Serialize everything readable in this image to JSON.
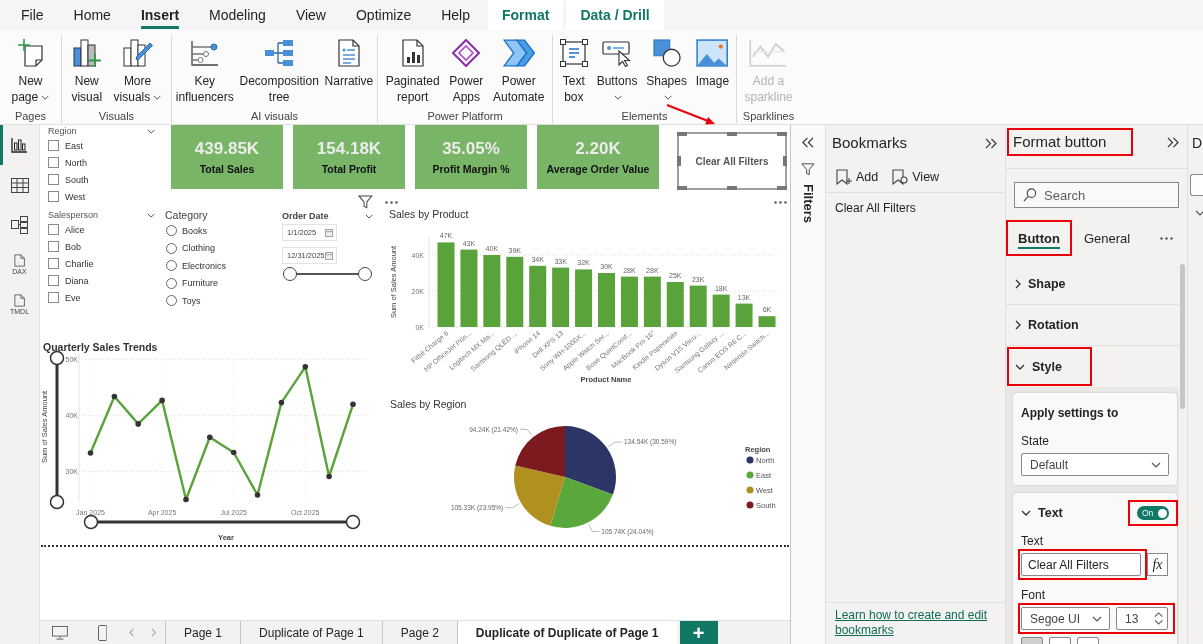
{
  "ribbon": {
    "tabs": [
      {
        "label": "File",
        "selected": false,
        "kind": "standard"
      },
      {
        "label": "Home",
        "selected": false,
        "kind": "standard"
      },
      {
        "label": "Insert",
        "selected": true,
        "kind": "standard"
      },
      {
        "label": "Modeling",
        "selected": false,
        "kind": "standard"
      },
      {
        "label": "View",
        "selected": false,
        "kind": "standard"
      },
      {
        "label": "Optimize",
        "selected": false,
        "kind": "standard"
      },
      {
        "label": "Help",
        "selected": false,
        "kind": "standard"
      },
      {
        "label": "Format",
        "selected": false,
        "kind": "contextual"
      },
      {
        "label": "Data / Drill",
        "selected": false,
        "kind": "contextual"
      }
    ],
    "groups": [
      {
        "label": "Pages",
        "buttons": [
          {
            "label": "New\npage",
            "dropdown": true,
            "disabled": false
          }
        ]
      },
      {
        "label": "Visuals",
        "buttons": [
          {
            "label": "New\nvisual",
            "dropdown": false,
            "disabled": false
          },
          {
            "label": "More\nvisuals",
            "dropdown": true,
            "disabled": false
          }
        ]
      },
      {
        "label": "AI visuals",
        "buttons": [
          {
            "label": "Key\ninfluencers",
            "dropdown": false,
            "disabled": false
          },
          {
            "label": "Decomposition\ntree",
            "dropdown": false,
            "disabled": false
          },
          {
            "label": "Narrative",
            "dropdown": false,
            "disabled": false
          }
        ]
      },
      {
        "label": "Power Platform",
        "buttons": [
          {
            "label": "Paginated\nreport",
            "dropdown": false,
            "disabled": false
          },
          {
            "label": "Power\nApps",
            "dropdown": false,
            "disabled": false
          },
          {
            "label": "Power\nAutomate",
            "dropdown": false,
            "disabled": false
          }
        ]
      },
      {
        "label": "Elements",
        "buttons": [
          {
            "label": "Text\nbox",
            "dropdown": false,
            "disabled": false
          },
          {
            "label": "Buttons",
            "dropdown": true,
            "disabled": false
          },
          {
            "label": "Shapes",
            "dropdown": true,
            "disabled": false
          },
          {
            "label": "Image",
            "dropdown": false,
            "disabled": false
          }
        ]
      },
      {
        "label": "Sparklines",
        "buttons": [
          {
            "label": "Add a\nsparkline",
            "dropdown": false,
            "disabled": true
          }
        ]
      }
    ]
  },
  "nav": [
    {
      "selected": true
    },
    {
      "selected": false
    },
    {
      "selected": false
    },
    {
      "label": "DAX",
      "selected": false
    },
    {
      "label": "TMDL",
      "selected": false
    }
  ],
  "canvas": {
    "region_slicer": {
      "title": "Region",
      "items": [
        {
          "label": "East",
          "checked": false
        },
        {
          "label": "North",
          "checked": false
        },
        {
          "label": "South",
          "checked": false
        },
        {
          "label": "West",
          "checked": false
        }
      ]
    },
    "salesperson_slicer": {
      "title": "Salesperson",
      "items": [
        {
          "label": "Alice",
          "checked": false
        },
        {
          "label": "Bob",
          "checked": false
        },
        {
          "label": "Charlie",
          "checked": false
        },
        {
          "label": "Diana",
          "checked": false
        },
        {
          "label": "Eve",
          "checked": false
        }
      ]
    },
    "category_slicer": {
      "title": "Category",
      "items": [
        {
          "label": "Books",
          "selected": false
        },
        {
          "label": "Clothing",
          "selected": false
        },
        {
          "label": "Electronics",
          "selected": false
        },
        {
          "label": "Furniture",
          "selected": false
        },
        {
          "label": "Toys",
          "selected": false
        }
      ]
    },
    "date_slicer": {
      "title": "Order Date",
      "start": "1/1/2025",
      "end": "12/31/2025",
      "handles": [
        {
          "level": 0
        },
        {
          "level": 1
        }
      ]
    },
    "kpi_cards": [
      {
        "value": "439.85K",
        "label": "Total Sales"
      },
      {
        "value": "154.18K",
        "label": "Total Profit"
      },
      {
        "value": "35.05%",
        "label": "Profit Margin %"
      },
      {
        "value": "2.20K",
        "label": "Average Order Value"
      }
    ],
    "clear_filters_button": {
      "label": "Clear All Filters",
      "selected": true
    },
    "sales_by_product": {
      "chart_data": {
        "type": "bar",
        "title": "Sales by Product",
        "xlabel": "Product Name",
        "ylabel": "Sum of Sales Amount",
        "categories": [
          "Fitbit Charge 6",
          "HP OfficeJet Prin...",
          "Logitech MX Ma...",
          "Samsung QLED ...",
          "iPhone 14",
          "Dell XPS 13",
          "Sony WH-1000X...",
          "Apple Watch Ser...",
          "Bose QuietComf...",
          "MacBook Pro 16\"",
          "Kindle Paperwhite",
          "Dyson V15 Vacu...",
          "Samsung Galaxy ...",
          "Canon EOS R6 C...",
          "Nintendo Switch..."
        ],
        "values": [
          47,
          43,
          40,
          39,
          34,
          33,
          32,
          30,
          28,
          28,
          25,
          23,
          18,
          13,
          6
        ],
        "ylim": [
          0,
          50
        ],
        "yticks": [
          {
            "value": 0,
            "label": "0K"
          },
          {
            "value": 20,
            "label": "20K"
          },
          {
            "value": 40,
            "label": "40K"
          }
        ],
        "grid": true,
        "value_labels": [
          "47K",
          "43K",
          "40K",
          "39K",
          "34K",
          "33K",
          "32K",
          "30K",
          "28K",
          "28K",
          "25K",
          "23K",
          "18K",
          "13K",
          "6K"
        ]
      }
    },
    "quarterly_sales_trends": {
      "chart_data": {
        "type": "line",
        "title": "Quarterly Sales Trends",
        "xlabel": "Year",
        "ylabel": "Sum of Sales Amount",
        "categories": [
          "Jan 2025",
          null,
          null,
          "Apr 2025",
          null,
          null,
          "Jul 2025",
          null,
          null,
          "Oct 2025",
          null,
          null
        ],
        "values": [
          33.3,
          43.4,
          38.5,
          42.7,
          25,
          36.1,
          33.4,
          25.8,
          42.3,
          48.7,
          29.1,
          42
        ],
        "ylim": [
          24.5,
          51
        ],
        "yticks": [
          {
            "value": 30,
            "label": "30K"
          },
          {
            "value": 40,
            "label": "40K"
          },
          {
            "value": 50,
            "label": "50K"
          }
        ],
        "grid": true
      },
      "zoom_sliders": {
        "x": [
          {
            "level": 0
          },
          {
            "level": 1
          }
        ],
        "y": [
          {
            "level": 0
          },
          {
            "level": 1
          }
        ]
      }
    },
    "sales_by_region": {
      "chart_data": {
        "type": "pie",
        "title": "Sales by Region",
        "categories": [
          "North",
          "East",
          "West",
          "South"
        ],
        "values": [
          30.59,
          24.04,
          23.95,
          21.42
        ],
        "value_labels": [
          "134.54K (30.59%)",
          "105.74K (24.04%)",
          "105.33K (23.95%)",
          "94.24K (21.42%)"
        ],
        "colors": [
          "#2c3566",
          "#5aa83c",
          "#b0901f",
          "#7d1a20"
        ],
        "legend": "right"
      },
      "legend_title": "Region"
    },
    "page_tabs": {
      "tabs": [
        {
          "label": "Page 1",
          "selected": false
        },
        {
          "label": "Duplicate of Page 1",
          "selected": false
        },
        {
          "label": "Page 2",
          "selected": false
        },
        {
          "label": "Duplicate of Duplicate of Page 1",
          "selected": true
        }
      ],
      "add_button": "+"
    }
  },
  "filters_pane": {
    "title": "Filters"
  },
  "bookmarks_pane": {
    "title": "Bookmarks",
    "actions": [
      {
        "label": "Add"
      },
      {
        "label": "View"
      }
    ],
    "items": [
      {
        "label": "Clear All Filters"
      }
    ],
    "help_link": "Learn how to create and edit bookmarks"
  },
  "format_pane": {
    "title": "Format button",
    "highlighted": true,
    "search": {
      "placeholder": "Search"
    },
    "tabs": [
      {
        "label": "Button",
        "selected": true,
        "highlighted": true
      },
      {
        "label": "General",
        "selected": false,
        "highlighted": false
      }
    ],
    "sections": [
      {
        "label": "Shape",
        "expanded": false,
        "highlighted": false
      },
      {
        "label": "Rotation",
        "expanded": false,
        "highlighted": false
      },
      {
        "label": "Style",
        "expanded": true,
        "highlighted": true
      }
    ],
    "apply_settings": {
      "title": "Apply settings to",
      "state_label": "State",
      "state_value": "Default"
    },
    "text_card": {
      "title": "Text",
      "expanded": true,
      "on": true,
      "toggle_label": "On",
      "toggle_highlighted": true,
      "text_label": "Text",
      "text_value": "Clear All Filters",
      "text_highlighted": true,
      "fx_label": "fx",
      "font_label": "Font",
      "font_value": "Segoe UI",
      "size_value": "13",
      "font_highlighted": true,
      "style_buttons": [
        {
          "selected": true
        },
        {
          "selected": false
        },
        {
          "selected": false
        }
      ]
    }
  },
  "next_pane": {
    "title": "D"
  }
}
